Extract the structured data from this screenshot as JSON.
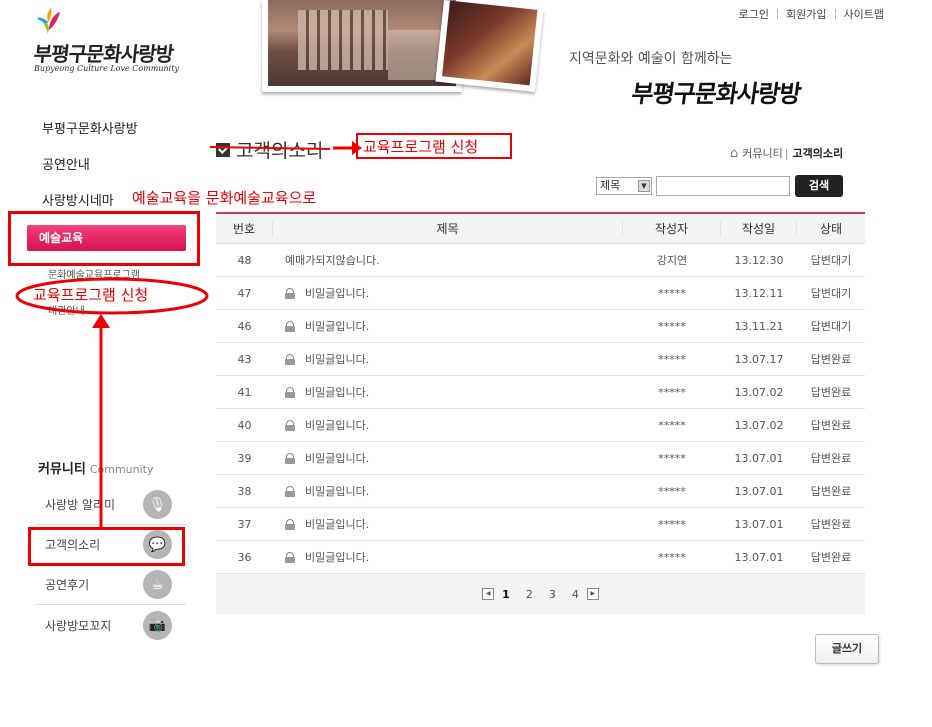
{
  "header": {
    "logo_name": "부평구문화사랑방",
    "logo_sub": "Bupyeong Culture Love Community",
    "tagline": "지역문화와 예술이 함께하는",
    "brand_text": "부평구문화사랑방",
    "topnav": [
      "로그인",
      "회원가입",
      "사이트맵"
    ]
  },
  "sidebar": {
    "menu": [
      "부평구문화사랑방",
      "공연안내",
      "사랑방시네마"
    ],
    "active": "예술교육",
    "subitems": [
      "문화예술교육프로그램",
      "대관안내"
    ],
    "community_title": "커뮤니티",
    "community_sub": "Community",
    "community_items": [
      {
        "label": "사랑방 알리미",
        "icon": "microphone-icon"
      },
      {
        "label": "고객의소리",
        "icon": "speech-bubble-icon"
      },
      {
        "label": "공연후기",
        "icon": "cup-icon"
      },
      {
        "label": "사랑방모꼬지",
        "icon": "camera-icon"
      }
    ]
  },
  "content": {
    "page_title": "고객의소리",
    "breadcrumb": {
      "parent": "커뮤니티",
      "current": "고객의소리"
    },
    "search": {
      "selected": "제목",
      "button": "검색"
    },
    "table": {
      "headers": [
        "번호",
        "제목",
        "작성자",
        "작성일",
        "상태"
      ],
      "rows": [
        {
          "no": "48",
          "title": "예매가되지않습니다.",
          "author": "강지연",
          "date": "13.12.30",
          "status": "답변대기",
          "locked": false
        },
        {
          "no": "47",
          "title": "비밀글입니다.",
          "author": "*****",
          "date": "13.12.11",
          "status": "답변대기",
          "locked": true
        },
        {
          "no": "46",
          "title": "비밀글입니다.",
          "author": "*****",
          "date": "13.11.21",
          "status": "답변대기",
          "locked": true
        },
        {
          "no": "43",
          "title": "비밀글입니다.",
          "author": "*****",
          "date": "13.07.17",
          "status": "답변완료",
          "locked": true
        },
        {
          "no": "41",
          "title": "비밀글입니다.",
          "author": "*****",
          "date": "13.07.02",
          "status": "답변완료",
          "locked": true
        },
        {
          "no": "40",
          "title": "비밀글입니다.",
          "author": "*****",
          "date": "13.07.02",
          "status": "답변완료",
          "locked": true
        },
        {
          "no": "39",
          "title": "비밀글입니다.",
          "author": "*****",
          "date": "13.07.01",
          "status": "답변완료",
          "locked": true
        },
        {
          "no": "38",
          "title": "비밀글입니다.",
          "author": "*****",
          "date": "13.07.01",
          "status": "답변완료",
          "locked": true
        },
        {
          "no": "37",
          "title": "비밀글입니다.",
          "author": "*****",
          "date": "13.07.01",
          "status": "답변완료",
          "locked": true
        },
        {
          "no": "36",
          "title": "비밀글입니다.",
          "author": "*****",
          "date": "13.07.01",
          "status": "답변완료",
          "locked": true
        }
      ]
    },
    "pager": {
      "pages": [
        "1",
        "2",
        "3",
        "4"
      ],
      "current": "1",
      "prev": "◀",
      "next": "▶"
    },
    "write_button": "글쓰기"
  },
  "annotations": {
    "title_replace": "교육프로그램 신청",
    "menu_note": "예술교육을  문화예술교육으로",
    "sub_replace": "교육프로그램 신청",
    "color": "#e00000"
  }
}
